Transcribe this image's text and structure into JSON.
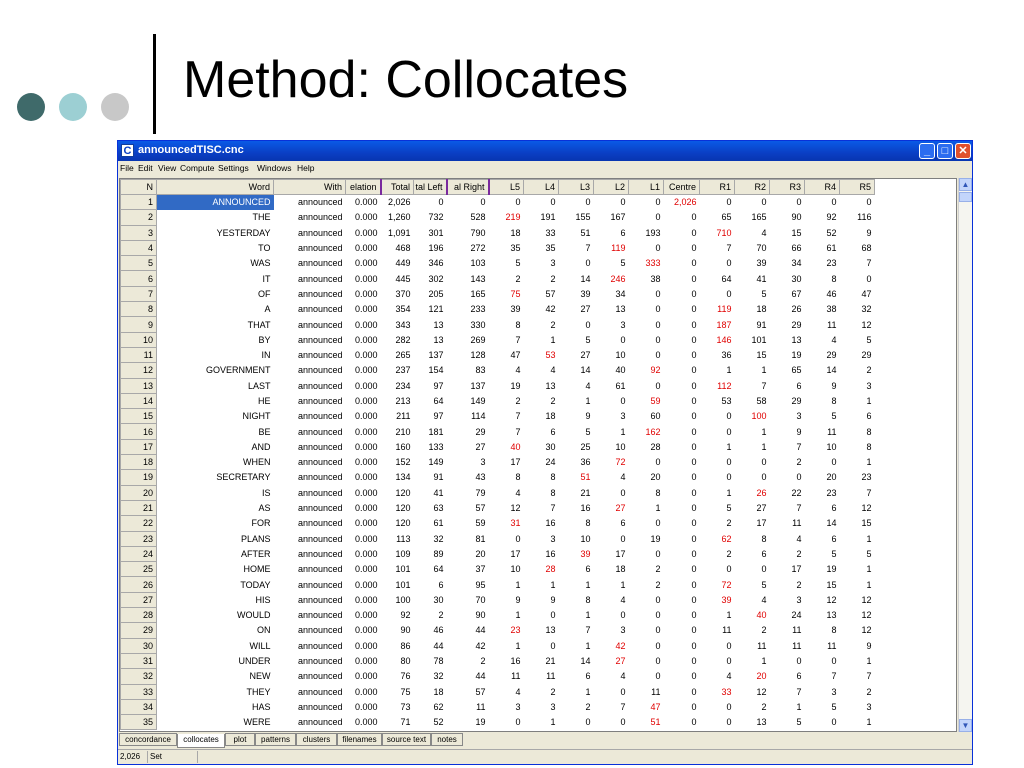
{
  "slide": {
    "title": "Method: Collocates"
  },
  "window": {
    "title": "announcedTISC.cnc",
    "app_icon": "C",
    "controls": {
      "min": "_",
      "max": "□",
      "close": "✕"
    }
  },
  "menu": [
    "File",
    "Edit",
    "View",
    "Compute",
    "Settings",
    "Windows",
    "Help"
  ],
  "table": {
    "columns": [
      "N",
      "Word",
      "With",
      "elation",
      "Total",
      "tal Left",
      "al Right",
      "L5",
      "L4",
      "L3",
      "L2",
      "L1",
      "Centre",
      "R1",
      "R2",
      "R3",
      "R4",
      "R5"
    ],
    "rows": [
      [
        "1",
        "ANNOUNCED",
        "announced",
        "0.000",
        "2,026",
        "0",
        "0",
        "0",
        "0",
        "0",
        "0",
        "0",
        "2,026",
        "0",
        "0",
        "0",
        "0",
        "0"
      ],
      [
        "2",
        "THE",
        "announced",
        "0.000",
        "1,260",
        "732",
        "528",
        "219",
        "191",
        "155",
        "167",
        "0",
        "0",
        "65",
        "165",
        "90",
        "92",
        "116"
      ],
      [
        "3",
        "YESTERDAY",
        "announced",
        "0.000",
        "1,091",
        "301",
        "790",
        "18",
        "33",
        "51",
        "6",
        "193",
        "0",
        "710",
        "4",
        "15",
        "52",
        "9"
      ],
      [
        "4",
        "TO",
        "announced",
        "0.000",
        "468",
        "196",
        "272",
        "35",
        "35",
        "7",
        "119",
        "0",
        "0",
        "7",
        "70",
        "66",
        "61",
        "68"
      ],
      [
        "5",
        "WAS",
        "announced",
        "0.000",
        "449",
        "346",
        "103",
        "5",
        "3",
        "0",
        "5",
        "333",
        "0",
        "0",
        "39",
        "34",
        "23",
        "7"
      ],
      [
        "6",
        "IT",
        "announced",
        "0.000",
        "445",
        "302",
        "143",
        "2",
        "2",
        "14",
        "246",
        "38",
        "0",
        "64",
        "41",
        "30",
        "8",
        "0"
      ],
      [
        "7",
        "OF",
        "announced",
        "0.000",
        "370",
        "205",
        "165",
        "75",
        "57",
        "39",
        "34",
        "0",
        "0",
        "0",
        "5",
        "67",
        "46",
        "47"
      ],
      [
        "8",
        "A",
        "announced",
        "0.000",
        "354",
        "121",
        "233",
        "39",
        "42",
        "27",
        "13",
        "0",
        "0",
        "119",
        "18",
        "26",
        "38",
        "32"
      ],
      [
        "9",
        "THAT",
        "announced",
        "0.000",
        "343",
        "13",
        "330",
        "8",
        "2",
        "0",
        "3",
        "0",
        "0",
        "187",
        "91",
        "29",
        "11",
        "12"
      ],
      [
        "10",
        "BY",
        "announced",
        "0.000",
        "282",
        "13",
        "269",
        "7",
        "1",
        "5",
        "0",
        "0",
        "0",
        "146",
        "101",
        "13",
        "4",
        "5"
      ],
      [
        "11",
        "IN",
        "announced",
        "0.000",
        "265",
        "137",
        "128",
        "47",
        "53",
        "27",
        "10",
        "0",
        "0",
        "36",
        "15",
        "19",
        "29",
        "29"
      ],
      [
        "12",
        "GOVERNMENT",
        "announced",
        "0.000",
        "237",
        "154",
        "83",
        "4",
        "4",
        "14",
        "40",
        "92",
        "0",
        "1",
        "1",
        "65",
        "14",
        "2"
      ],
      [
        "13",
        "LAST",
        "announced",
        "0.000",
        "234",
        "97",
        "137",
        "19",
        "13",
        "4",
        "61",
        "0",
        "0",
        "112",
        "7",
        "6",
        "9",
        "3"
      ],
      [
        "14",
        "HE",
        "announced",
        "0.000",
        "213",
        "64",
        "149",
        "2",
        "2",
        "1",
        "0",
        "59",
        "0",
        "53",
        "58",
        "29",
        "8",
        "1"
      ],
      [
        "15",
        "NIGHT",
        "announced",
        "0.000",
        "211",
        "97",
        "114",
        "7",
        "18",
        "9",
        "3",
        "60",
        "0",
        "0",
        "100",
        "3",
        "5",
        "6"
      ],
      [
        "16",
        "BE",
        "announced",
        "0.000",
        "210",
        "181",
        "29",
        "7",
        "6",
        "5",
        "1",
        "162",
        "0",
        "0",
        "1",
        "9",
        "11",
        "8"
      ],
      [
        "17",
        "AND",
        "announced",
        "0.000",
        "160",
        "133",
        "27",
        "40",
        "30",
        "25",
        "10",
        "28",
        "0",
        "1",
        "1",
        "7",
        "10",
        "8"
      ],
      [
        "18",
        "WHEN",
        "announced",
        "0.000",
        "152",
        "149",
        "3",
        "17",
        "24",
        "36",
        "72",
        "0",
        "0",
        "0",
        "0",
        "2",
        "0",
        "1"
      ],
      [
        "19",
        "SECRETARY",
        "announced",
        "0.000",
        "134",
        "91",
        "43",
        "8",
        "8",
        "51",
        "4",
        "20",
        "0",
        "0",
        "0",
        "0",
        "20",
        "23"
      ],
      [
        "20",
        "IS",
        "announced",
        "0.000",
        "120",
        "41",
        "79",
        "4",
        "8",
        "21",
        "0",
        "8",
        "0",
        "1",
        "26",
        "22",
        "23",
        "7"
      ],
      [
        "21",
        "AS",
        "announced",
        "0.000",
        "120",
        "63",
        "57",
        "12",
        "7",
        "16",
        "27",
        "1",
        "0",
        "5",
        "27",
        "7",
        "6",
        "12"
      ],
      [
        "22",
        "FOR",
        "announced",
        "0.000",
        "120",
        "61",
        "59",
        "31",
        "16",
        "8",
        "6",
        "0",
        "0",
        "2",
        "17",
        "11",
        "14",
        "15"
      ],
      [
        "23",
        "PLANS",
        "announced",
        "0.000",
        "113",
        "32",
        "81",
        "0",
        "3",
        "10",
        "0",
        "19",
        "0",
        "62",
        "8",
        "4",
        "6",
        "1"
      ],
      [
        "24",
        "AFTER",
        "announced",
        "0.000",
        "109",
        "89",
        "20",
        "17",
        "16",
        "39",
        "17",
        "0",
        "0",
        "2",
        "6",
        "2",
        "5",
        "5"
      ],
      [
        "25",
        "HOME",
        "announced",
        "0.000",
        "101",
        "64",
        "37",
        "10",
        "28",
        "6",
        "18",
        "2",
        "0",
        "0",
        "0",
        "17",
        "19",
        "1"
      ],
      [
        "26",
        "TODAY",
        "announced",
        "0.000",
        "101",
        "6",
        "95",
        "1",
        "1",
        "1",
        "1",
        "2",
        "0",
        "72",
        "5",
        "2",
        "15",
        "1"
      ],
      [
        "27",
        "HIS",
        "announced",
        "0.000",
        "100",
        "30",
        "70",
        "9",
        "9",
        "8",
        "4",
        "0",
        "0",
        "39",
        "4",
        "3",
        "12",
        "12"
      ],
      [
        "28",
        "WOULD",
        "announced",
        "0.000",
        "92",
        "2",
        "90",
        "1",
        "0",
        "1",
        "0",
        "0",
        "0",
        "1",
        "40",
        "24",
        "13",
        "12"
      ],
      [
        "29",
        "ON",
        "announced",
        "0.000",
        "90",
        "46",
        "44",
        "23",
        "13",
        "7",
        "3",
        "0",
        "0",
        "11",
        "2",
        "11",
        "8",
        "12"
      ],
      [
        "30",
        "WILL",
        "announced",
        "0.000",
        "86",
        "44",
        "42",
        "1",
        "0",
        "1",
        "42",
        "0",
        "0",
        "0",
        "11",
        "11",
        "11",
        "9"
      ],
      [
        "31",
        "UNDER",
        "announced",
        "0.000",
        "80",
        "78",
        "2",
        "16",
        "21",
        "14",
        "27",
        "0",
        "0",
        "0",
        "1",
        "0",
        "0",
        "1"
      ],
      [
        "32",
        "NEW",
        "announced",
        "0.000",
        "76",
        "32",
        "44",
        "11",
        "11",
        "6",
        "4",
        "0",
        "0",
        "4",
        "20",
        "6",
        "7",
        "7"
      ],
      [
        "33",
        "THEY",
        "announced",
        "0.000",
        "75",
        "18",
        "57",
        "4",
        "2",
        "1",
        "0",
        "11",
        "0",
        "33",
        "12",
        "7",
        "3",
        "2"
      ],
      [
        "34",
        "HAS",
        "announced",
        "0.000",
        "73",
        "62",
        "11",
        "3",
        "3",
        "2",
        "7",
        "47",
        "0",
        "0",
        "2",
        "1",
        "5",
        "3"
      ],
      [
        "35",
        "WERE",
        "announced",
        "0.000",
        "71",
        "52",
        "19",
        "0",
        "1",
        "0",
        "0",
        "51",
        "0",
        "0",
        "13",
        "5",
        "0",
        "1"
      ]
    ],
    "highlight_color": "#e00000",
    "highlight_rule": "largest positional value (L5–R5) in each row shown in red"
  },
  "tabs": [
    {
      "label": "concordance",
      "active": false
    },
    {
      "label": "collocates",
      "active": true
    },
    {
      "label": "plot",
      "active": false
    },
    {
      "label": "patterns",
      "active": false
    },
    {
      "label": "clusters",
      "active": false
    },
    {
      "label": "filenames",
      "active": false
    },
    {
      "label": "source text",
      "active": false
    },
    {
      "label": "notes",
      "active": false
    }
  ],
  "status": {
    "count": "2,026",
    "label": "Set"
  },
  "scroll": {
    "up_icon": "▲",
    "down_icon": "▼"
  }
}
